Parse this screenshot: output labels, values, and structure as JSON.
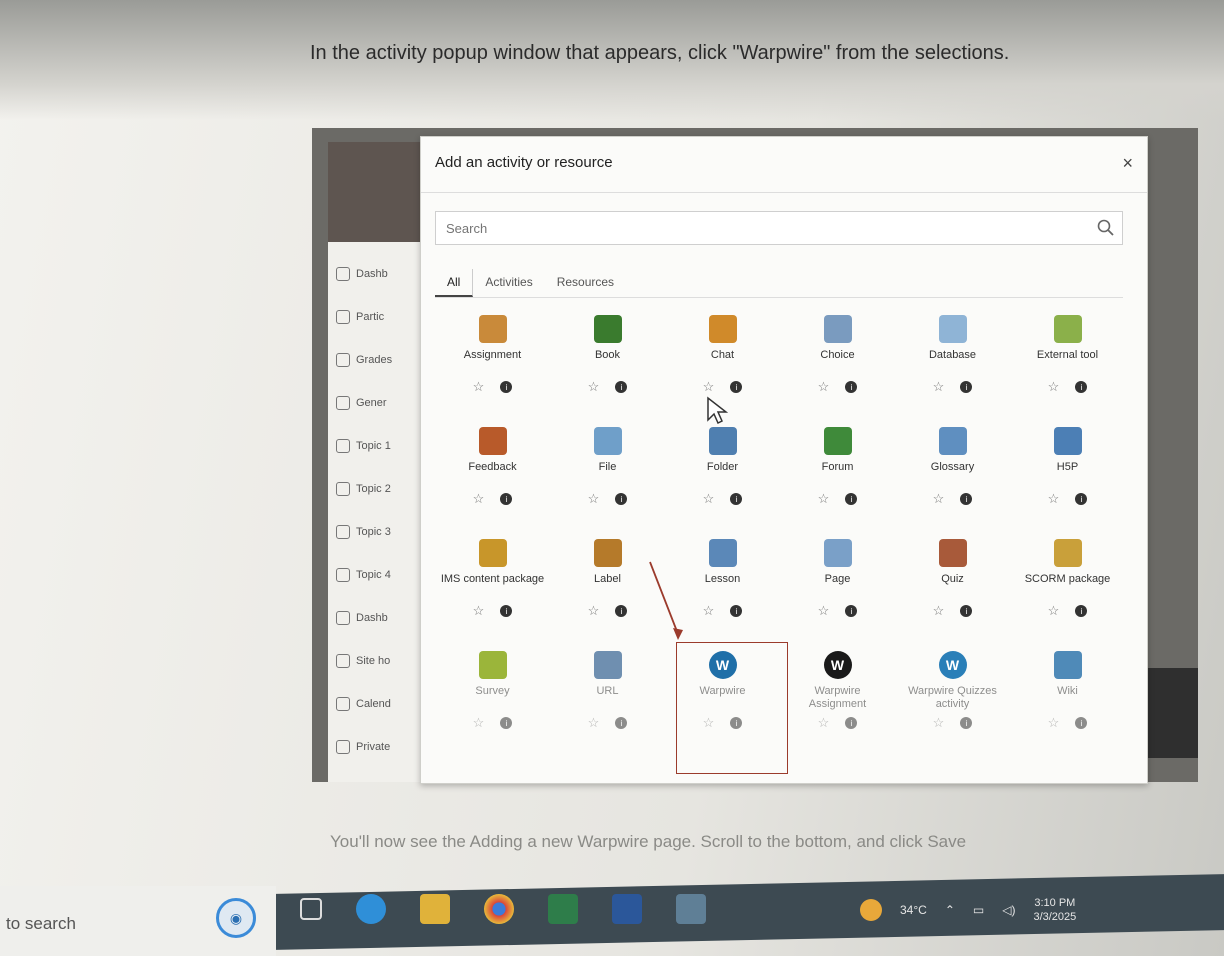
{
  "document": {
    "instruction_top": "In the activity popup window that appears, click \"Warpwire\" from the selections.",
    "instruction_bottom": "You'll now see the Adding a new Warpwire page. Scroll to the bottom, and click Save"
  },
  "lms_sidebar": {
    "items": [
      {
        "label": "Dashb",
        "icon": "home-icon"
      },
      {
        "label": "Partic",
        "icon": "users-icon"
      },
      {
        "label": "Grades",
        "icon": "grades-icon"
      },
      {
        "label": "Gener",
        "icon": "folder-icon"
      },
      {
        "label": "Topic 1",
        "icon": "folder-icon"
      },
      {
        "label": "Topic 2",
        "icon": "folder-icon"
      },
      {
        "label": "Topic 3",
        "icon": "folder-icon"
      },
      {
        "label": "Topic 4",
        "icon": "folder-icon"
      },
      {
        "label": "Dashb",
        "icon": "dashboard-icon"
      },
      {
        "label": "Site ho",
        "icon": "pin-icon"
      },
      {
        "label": "Calend",
        "icon": "calendar-icon"
      },
      {
        "label": "Private",
        "icon": "file-icon"
      }
    ]
  },
  "modal": {
    "title": "Add an activity or resource",
    "close": "×",
    "search_placeholder": "Search",
    "tabs": [
      "All",
      "Activities",
      "Resources"
    ],
    "items": [
      {
        "name": "Assignment",
        "color": "#c98a3a"
      },
      {
        "name": "Book",
        "color": "#3a7b2e"
      },
      {
        "name": "Chat",
        "color": "#d08a2a"
      },
      {
        "name": "Choice",
        "color": "#7a9bbf"
      },
      {
        "name": "Database",
        "color": "#8fb4d6"
      },
      {
        "name": "External tool",
        "color": "#8bb04a"
      },
      {
        "name": "Feedback",
        "color": "#b85a2a"
      },
      {
        "name": "File",
        "color": "#6f9fc9"
      },
      {
        "name": "Folder",
        "color": "#4f7fb0"
      },
      {
        "name": "Forum",
        "color": "#3f8a3a"
      },
      {
        "name": "Glossary",
        "color": "#5f8fc0"
      },
      {
        "name": "H5P",
        "color": "#4c7fb5"
      },
      {
        "name": "IMS content package",
        "color": "#c8962a"
      },
      {
        "name": "Label",
        "color": "#b57a2a"
      },
      {
        "name": "Lesson",
        "color": "#5b88b8"
      },
      {
        "name": "Page",
        "color": "#7aa0c8"
      },
      {
        "name": "Quiz",
        "color": "#a85a3a"
      },
      {
        "name": "SCORM package",
        "color": "#c9a03a"
      },
      {
        "name": "Survey",
        "color": "#9bb53a"
      },
      {
        "name": "URL",
        "color": "#6f8fb0"
      },
      {
        "name": "Warpwire",
        "color": "#1f6fa8"
      },
      {
        "name": "Warpwire Assignment",
        "color": "#1a1a1a"
      },
      {
        "name": "Warpwire Quizzes activity",
        "color": "#2a7fb8"
      },
      {
        "name": "Wiki",
        "color": "#4f8ab8"
      }
    ]
  },
  "taskbar": {
    "search_text": "to search",
    "weather": "34°C",
    "time": "3:10 PM",
    "date": "3/3/2025"
  }
}
